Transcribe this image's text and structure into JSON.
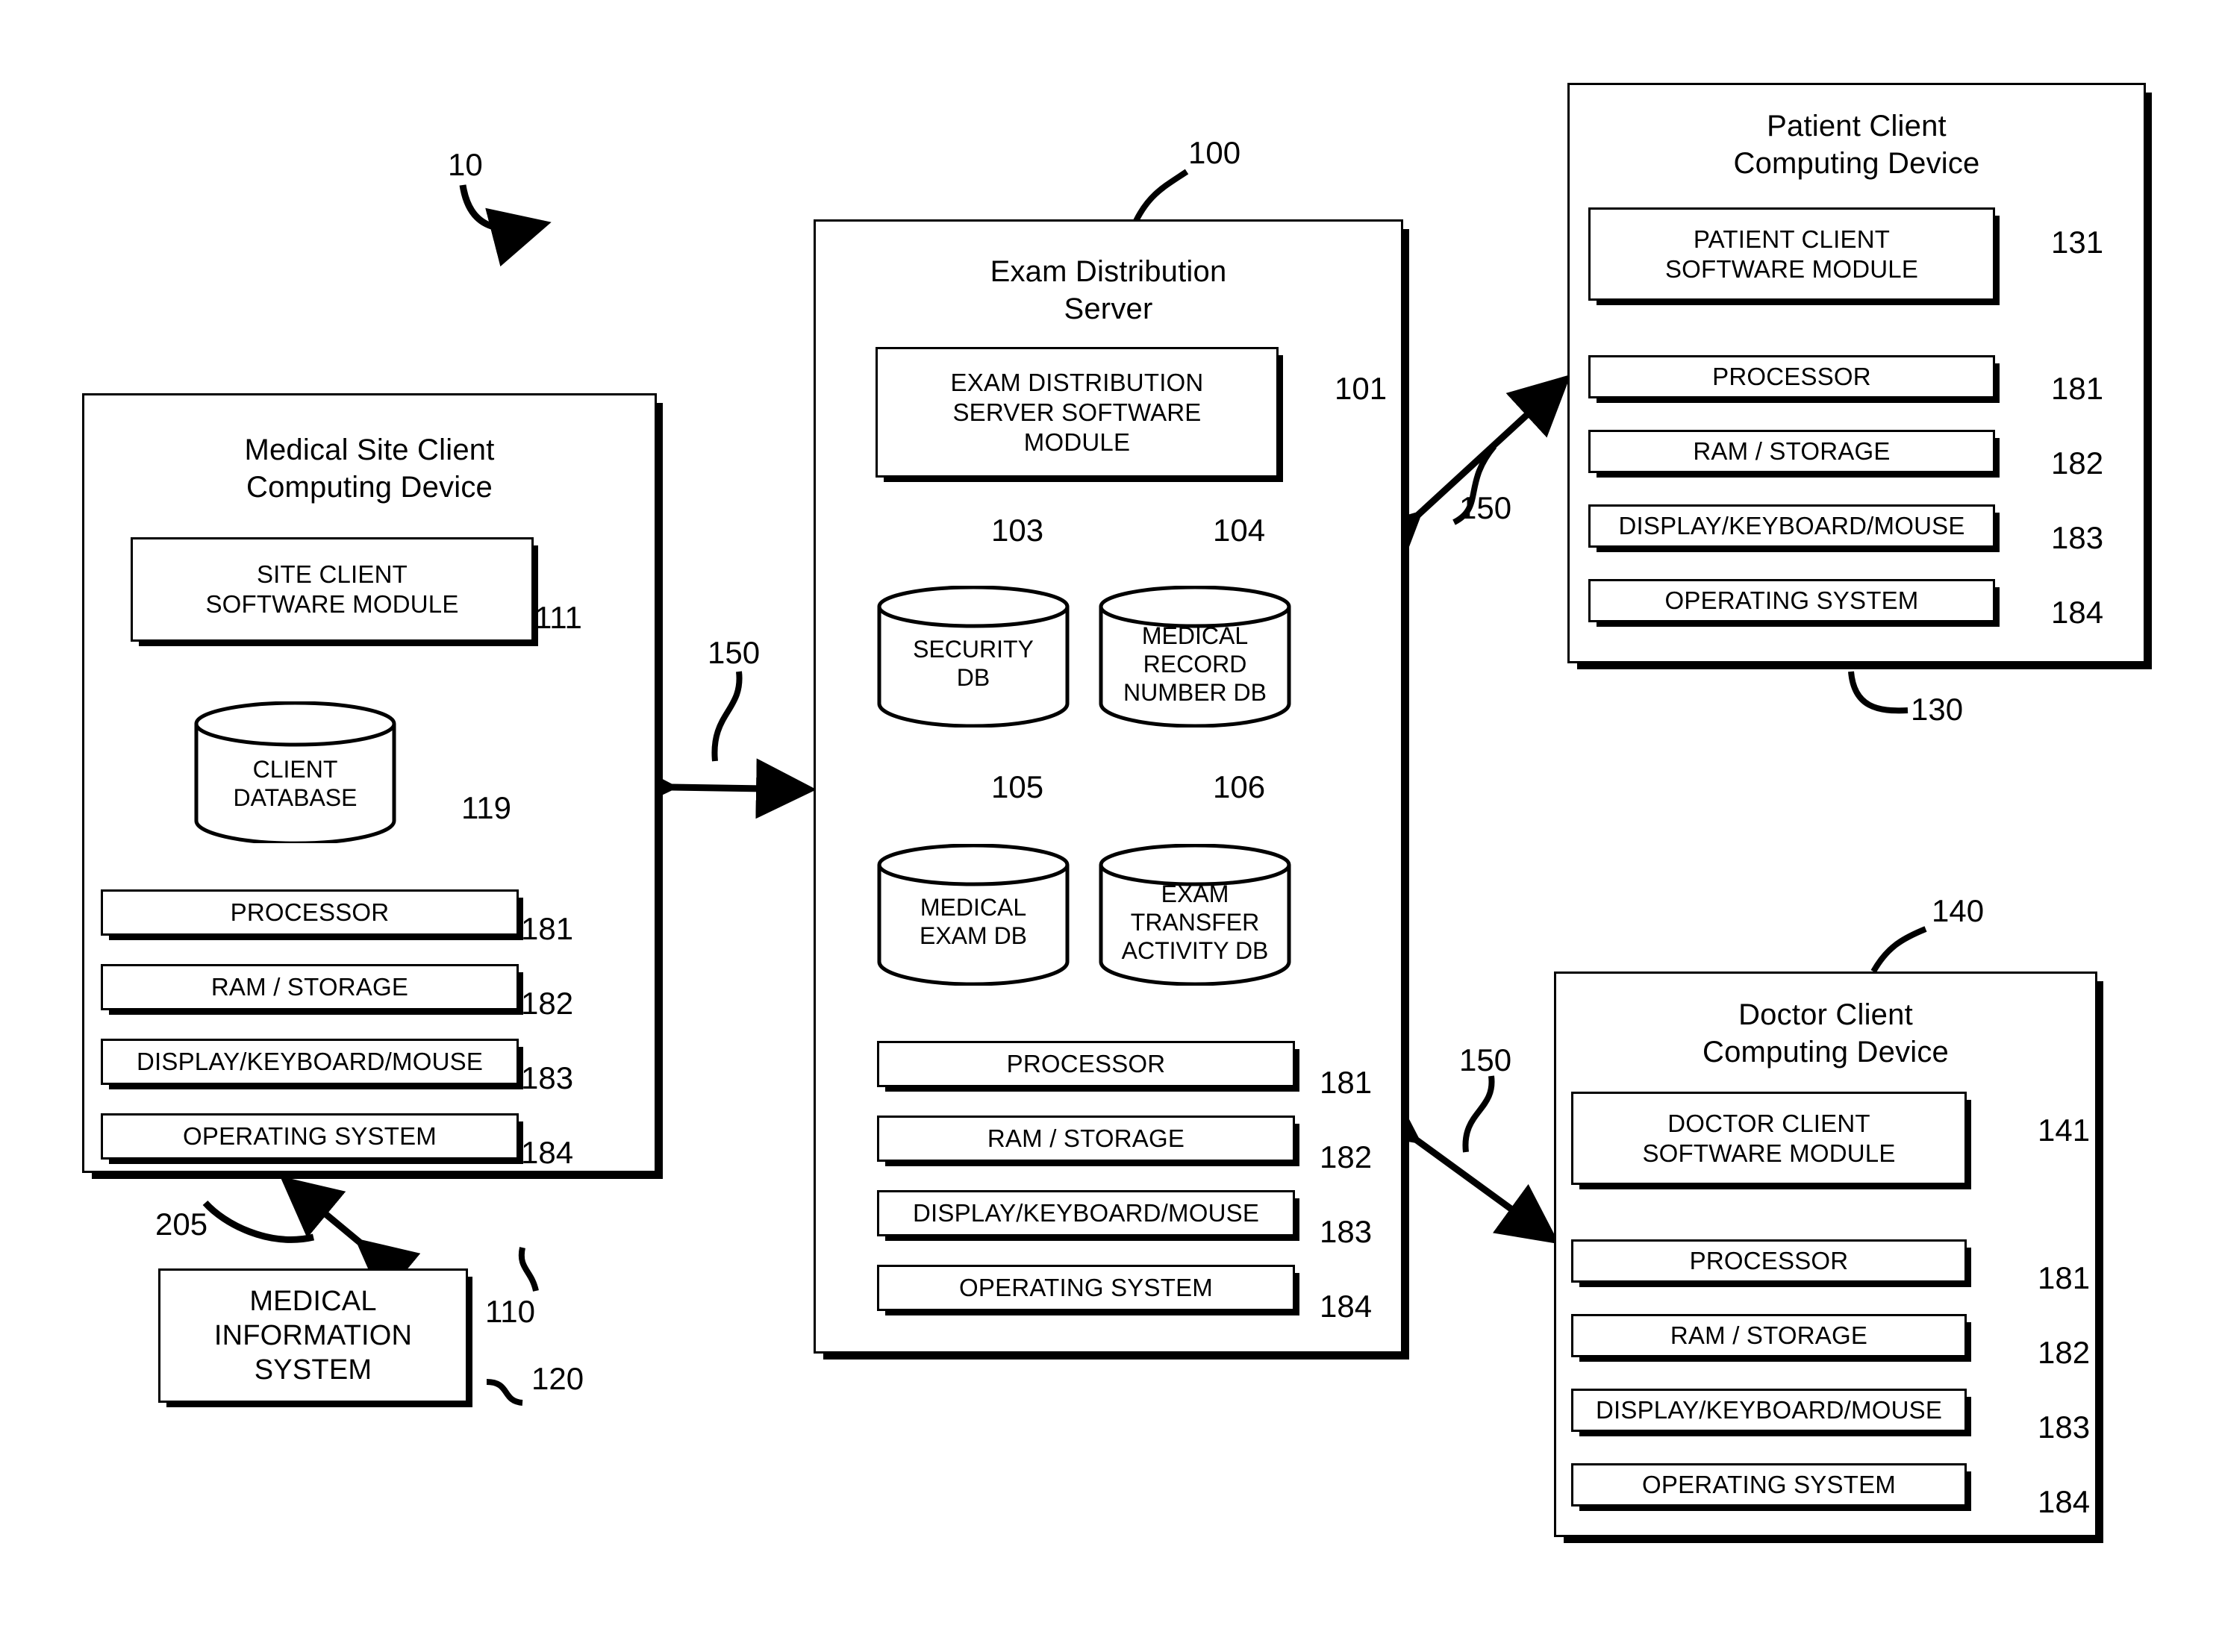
{
  "figure": {
    "system_numeral": "10"
  },
  "server": {
    "title_line1": "Exam Distribution",
    "title_line2": "Server",
    "numeral": "100",
    "software_module": {
      "label_line1": "EXAM DISTRIBUTION",
      "label_line2": "SERVER SOFTWARE",
      "label_line3": "MODULE",
      "numeral": "101"
    },
    "databases": [
      {
        "numeral": "103",
        "label_line1": "SECURITY",
        "label_line2": "DB",
        "label_line3": ""
      },
      {
        "numeral": "104",
        "label_line1": "MEDICAL",
        "label_line2": "RECORD",
        "label_line3": "NUMBER DB"
      },
      {
        "numeral": "105",
        "label_line1": "MEDICAL",
        "label_line2": "EXAM DB",
        "label_line3": ""
      },
      {
        "numeral": "106",
        "label_line1": "EXAM",
        "label_line2": "TRANSFER",
        "label_line3": "ACTIVITY DB"
      }
    ],
    "hardware": [
      {
        "label": "PROCESSOR",
        "numeral": "181"
      },
      {
        "label": "RAM / STORAGE",
        "numeral": "182"
      },
      {
        "label": "DISPLAY/KEYBOARD/MOUSE",
        "numeral": "183"
      },
      {
        "label": "OPERATING SYSTEM",
        "numeral": "184"
      }
    ]
  },
  "site_client": {
    "title_line1": "Medical Site Client",
    "title_line2": "Computing Device",
    "numeral": "110",
    "software_module": {
      "label_line1": "SITE CLIENT",
      "label_line2": "SOFTWARE MODULE",
      "numeral": "111"
    },
    "database": {
      "numeral": "119",
      "label_line1": "CLIENT",
      "label_line2": "DATABASE"
    },
    "hardware": [
      {
        "label": "PROCESSOR",
        "numeral": "181"
      },
      {
        "label": "RAM / STORAGE",
        "numeral": "182"
      },
      {
        "label": "DISPLAY/KEYBOARD/MOUSE",
        "numeral": "183"
      },
      {
        "label": "OPERATING SYSTEM",
        "numeral": "184"
      }
    ]
  },
  "medical_information_system": {
    "label_line1": "MEDICAL",
    "label_line2": "INFORMATION",
    "label_line3": "SYSTEM",
    "numeral": "120",
    "link_numeral": "205"
  },
  "patient_client": {
    "title_line1": "Patient Client",
    "title_line2": "Computing Device",
    "numeral": "130",
    "software_module": {
      "label_line1": "PATIENT CLIENT",
      "label_line2": "SOFTWARE MODULE",
      "numeral": "131"
    },
    "hardware": [
      {
        "label": "PROCESSOR",
        "numeral": "181"
      },
      {
        "label": "RAM / STORAGE",
        "numeral": "182"
      },
      {
        "label": "DISPLAY/KEYBOARD/MOUSE",
        "numeral": "183"
      },
      {
        "label": "OPERATING SYSTEM",
        "numeral": "184"
      }
    ]
  },
  "doctor_client": {
    "title_line1": "Doctor Client",
    "title_line2": "Computing Device",
    "numeral": "140",
    "software_module": {
      "label_line1": "DOCTOR CLIENT",
      "label_line2": "SOFTWARE MODULE",
      "numeral": "141"
    },
    "hardware": [
      {
        "label": "PROCESSOR",
        "numeral": "181"
      },
      {
        "label": "RAM / STORAGE",
        "numeral": "182"
      },
      {
        "label": "DISPLAY/KEYBOARD/MOUSE",
        "numeral": "183"
      },
      {
        "label": "OPERATING SYSTEM",
        "numeral": "184"
      }
    ]
  },
  "networks": {
    "site_to_server": "150",
    "server_to_patient": "150",
    "server_to_doctor": "150"
  }
}
